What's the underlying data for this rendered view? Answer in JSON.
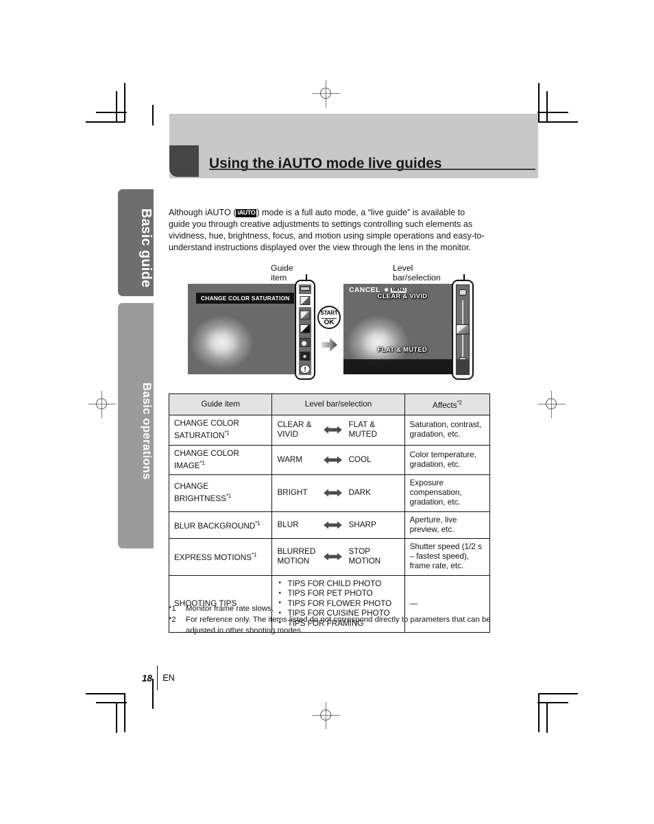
{
  "header": {
    "title": "Using the iAUTO mode live guides"
  },
  "sidebar": {
    "tabs": [
      {
        "label": "Basic guide",
        "state": "active",
        "color": "#6e6e6e"
      },
      {
        "label": "Basic operations",
        "state": "inactive",
        "color": "#9b9b9b"
      }
    ]
  },
  "intro": {
    "part1": "Although iAUTO (",
    "badge": "iAUTO",
    "part2": ") mode is a full auto mode, a “live guide” is available to guide you through creative adjustments to settings controlling such elements as vividness, hue, brightness, focus, and motion using simple operations and easy-to-understand instructions displayed over the view through the lens in the monitor."
  },
  "figure": {
    "callout_left": "Guide item",
    "callout_right": "Level bar/selection",
    "screen1": {
      "osd_title": "CHANGE COLOR SATURATION"
    },
    "screen2": {
      "top_text": "CLEAR & VIVID",
      "bottom_text": "FLAT & MUTED",
      "cancel_label": "CANCEL",
      "cancel_arrow": "✷",
      "menu_badge": "MENU"
    },
    "button": {
      "line1": "START",
      "line2": "OK"
    }
  },
  "table": {
    "headers": [
      "Guide item",
      "Level bar/selection",
      "Affects"
    ],
    "affects_sup": "*2",
    "rows": [
      {
        "guide": "CHANGE COLOR SATURATION",
        "guide_sup": "*1",
        "level_left": "CLEAR & VIVID",
        "level_right": "FLAT & MUTED",
        "affects": "Saturation, contrast, gradation, etc."
      },
      {
        "guide": "CHANGE COLOR IMAGE",
        "guide_sup": "*1",
        "level_left": "WARM",
        "level_right": "COOL",
        "affects": "Color temperature, gradation, etc."
      },
      {
        "guide": "CHANGE BRIGHTNESS",
        "guide_sup": "*1",
        "level_left": "BRIGHT",
        "level_right": "DARK",
        "affects": "Exposure compensation, gradation, etc."
      },
      {
        "guide": "BLUR BACKGROUND",
        "guide_sup": "*1",
        "level_left": "BLUR",
        "level_right": "SHARP",
        "affects": "Aperture, live preview, etc."
      },
      {
        "guide": "EXPRESS MOTIONS",
        "guide_sup": "*1",
        "level_left": "BLURRED MOTION",
        "level_right": "STOP MOTION",
        "affects": "Shutter speed (1/2 s – fastest speed), frame rate, etc."
      }
    ],
    "tips_row": {
      "guide": "SHOOTING TIPS",
      "guide_sup": "",
      "tips": [
        "TIPS FOR CHILD PHOTO",
        "TIPS FOR PET PHOTO",
        "TIPS FOR FLOWER PHOTO",
        "TIPS FOR CUISINE PHOTO",
        "TIPS FOR FRAMING"
      ],
      "affects": "—"
    }
  },
  "footnotes": [
    {
      "key": "*1",
      "text": "Monitor frame rate slows."
    },
    {
      "key": "*2",
      "text": "For reference only. The items listed do not correspond directly to parameters that can be adjusted in other shooting modes."
    }
  ],
  "footer": {
    "page": "18",
    "lang": "EN"
  }
}
